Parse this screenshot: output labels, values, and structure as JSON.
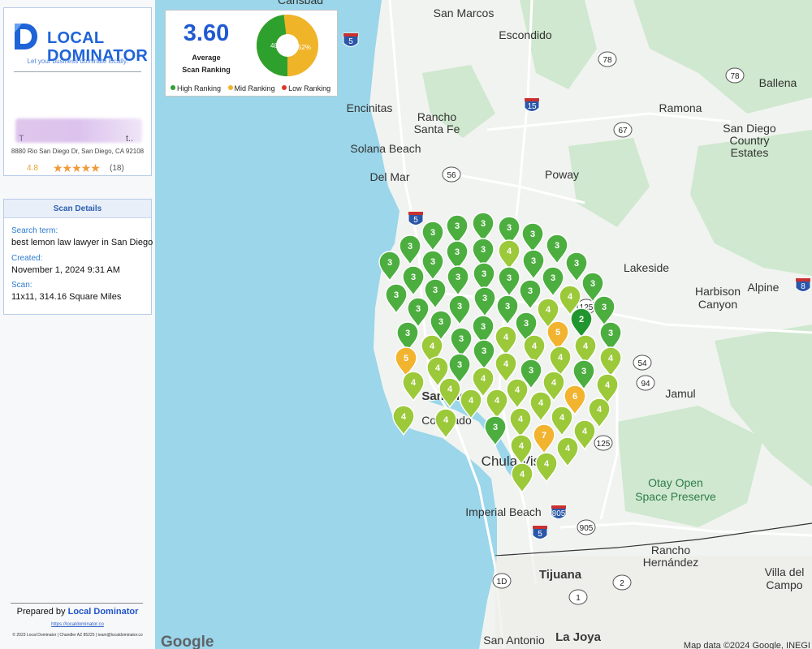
{
  "brand": {
    "name_line1": "LOCAL",
    "name_line2": "DOMINATOR",
    "tagline": "Let your business dominate locally."
  },
  "business": {
    "name_visible": "T",
    "name_tail": "t..",
    "address": "8880 Rio San Diego Dr, San Diego, CA 92108",
    "rating": "4.8",
    "stars": "★★★★★",
    "reviews": "(18)"
  },
  "scan": {
    "header": "Scan Details",
    "search_label": "Search term:",
    "search_value": "best lemon law lawyer in San Diego",
    "created_label": "Created:",
    "created_value": "November 1, 2024 9:31 AM",
    "scan_label": "Scan:",
    "scan_value": "11x11, 314.16 Square Miles"
  },
  "summary": {
    "score": "3.60",
    "score_label1": "Average",
    "score_label2": "Scan Ranking",
    "high_pct": "48%",
    "mid_pct": "52%",
    "high_fraction": 0.48,
    "mid_fraction": 0.52,
    "legend": [
      {
        "label": "High Ranking",
        "color": "#2ea02e"
      },
      {
        "label": "Mid Ranking",
        "color": "#f0b429"
      },
      {
        "label": "Low Ranking",
        "color": "#e0352b"
      }
    ]
  },
  "footer": {
    "prepared_prefix": "Prepared by ",
    "prepared_brand": "Local Dominator",
    "site": "https://localdominator.co",
    "fine_print": "© 2023 Local Dominator | Chandler AZ 85225 | team@localdominator.co"
  },
  "map": {
    "places": [
      "Carlsbad",
      "San Marcos",
      "Escondido",
      "Encinitas",
      "Rancho",
      "Santa Fe",
      "Solana Beach",
      "Del Mar",
      "Poway",
      "Ramona",
      "San Diego",
      "Country",
      "Estates",
      "Ballena",
      "Lakeside",
      "Harbison",
      "Canyon",
      "Alpine",
      "Jamul",
      "Otay Open",
      "Space Preserve",
      "Imperial Beach",
      "Rancho",
      "Hernández",
      "Tijuana",
      "Villa del",
      "Campo",
      "San Antonio",
      "La Joya",
      "Chula Vista",
      "San Diego",
      "Coronado"
    ],
    "routes": [
      "5",
      "15",
      "78",
      "78",
      "67",
      "56",
      "5",
      "8",
      "125",
      "54",
      "94",
      "125",
      "805",
      "5",
      "905",
      "1D",
      "2",
      "1"
    ],
    "attribution": "Map data ©2024 Google, INEGI",
    "google": "Google"
  },
  "pins": [
    {
      "r": "3",
      "l": "high"
    },
    {
      "r": "3",
      "l": "high"
    },
    {
      "r": "3",
      "l": "high"
    },
    {
      "r": "3",
      "l": "high"
    },
    {
      "r": "3",
      "l": "high"
    },
    {
      "r": "3",
      "l": "high"
    },
    {
      "r": "3",
      "l": "high"
    },
    {
      "r": "3",
      "l": "high"
    },
    {
      "r": "3",
      "l": "high"
    },
    {
      "r": "4",
      "l": "mid"
    },
    {
      "r": "3",
      "l": "high"
    },
    {
      "r": "3",
      "l": "high"
    },
    {
      "r": "3",
      "l": "high"
    },
    {
      "r": "3",
      "l": "high"
    },
    {
      "r": "3",
      "l": "high"
    },
    {
      "r": "3",
      "l": "high"
    },
    {
      "r": "3",
      "l": "high"
    },
    {
      "r": "3",
      "l": "high"
    },
    {
      "r": "3",
      "l": "high"
    },
    {
      "r": "3",
      "l": "high"
    },
    {
      "r": "3",
      "l": "high"
    },
    {
      "r": "3",
      "l": "high"
    },
    {
      "r": "3",
      "l": "high"
    },
    {
      "r": "3",
      "l": "high"
    },
    {
      "r": "3",
      "l": "high"
    },
    {
      "r": "4",
      "l": "mid"
    },
    {
      "r": "3",
      "l": "high"
    },
    {
      "r": "3",
      "l": "high"
    },
    {
      "r": "3",
      "l": "high"
    },
    {
      "r": "4",
      "l": "mid"
    },
    {
      "r": "3",
      "l": "high"
    },
    {
      "r": "3",
      "l": "high"
    },
    {
      "r": "3",
      "l": "high"
    },
    {
      "r": "3",
      "l": "high"
    },
    {
      "r": "4",
      "l": "mid"
    },
    {
      "r": "3",
      "l": "high"
    },
    {
      "r": "5",
      "l": "mid"
    },
    {
      "r": "2",
      "l": "high"
    },
    {
      "r": "3",
      "l": "high"
    },
    {
      "r": "4",
      "l": "mid"
    },
    {
      "r": "3",
      "l": "high"
    },
    {
      "r": "4",
      "l": "mid"
    },
    {
      "r": "4",
      "l": "mid"
    },
    {
      "r": "4",
      "l": "mid"
    },
    {
      "r": "4",
      "l": "mid"
    },
    {
      "r": "5",
      "l": "mid"
    },
    {
      "r": "4",
      "l": "mid"
    },
    {
      "r": "3",
      "l": "high"
    },
    {
      "r": "4",
      "l": "mid"
    },
    {
      "r": "3",
      "l": "high"
    },
    {
      "r": "3",
      "l": "high"
    },
    {
      "r": "4",
      "l": "mid"
    },
    {
      "r": "4",
      "l": "mid"
    },
    {
      "r": "4",
      "l": "mid"
    },
    {
      "r": "4",
      "l": "mid"
    },
    {
      "r": "4",
      "l": "mid"
    },
    {
      "r": "4",
      "l": "mid"
    },
    {
      "r": "4",
      "l": "mid"
    },
    {
      "r": "4",
      "l": "mid"
    },
    {
      "r": "6",
      "l": "mid"
    },
    {
      "r": "4",
      "l": "mid"
    },
    {
      "r": "4",
      "l": "mid"
    },
    {
      "r": "4",
      "l": "mid"
    },
    {
      "r": "3",
      "l": "high"
    },
    {
      "r": "4",
      "l": "mid"
    },
    {
      "r": "4",
      "l": "mid"
    },
    {
      "r": "4",
      "l": "mid"
    },
    {
      "r": "4",
      "l": "mid"
    },
    {
      "r": "4",
      "l": "mid"
    },
    {
      "r": "7",
      "l": "mid"
    },
    {
      "r": "4",
      "l": "mid"
    },
    {
      "r": "4",
      "l": "mid"
    },
    {
      "r": "4",
      "l": "mid"
    },
    {
      "r": "4",
      "l": "mid"
    },
    {
      "r": "4",
      "l": "mid"
    }
  ],
  "colors": {
    "high": "#4cae3f",
    "high_dark": "#22962e",
    "mid": "#9bc93a",
    "mid_orange": "#f2b32f",
    "accent": "#1f63d8"
  }
}
